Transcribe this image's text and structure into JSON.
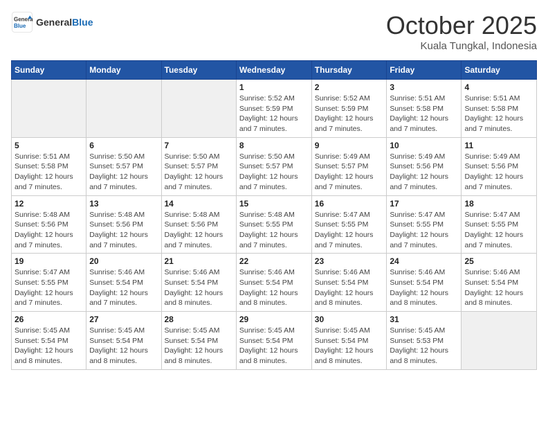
{
  "logo": {
    "general": "General",
    "blue": "Blue"
  },
  "header": {
    "month": "October 2025",
    "location": "Kuala Tungkal, Indonesia"
  },
  "weekdays": [
    "Sunday",
    "Monday",
    "Tuesday",
    "Wednesday",
    "Thursday",
    "Friday",
    "Saturday"
  ],
  "weeks": [
    [
      {
        "day": "",
        "info": "",
        "empty": true
      },
      {
        "day": "",
        "info": "",
        "empty": true
      },
      {
        "day": "",
        "info": "",
        "empty": true
      },
      {
        "day": "1",
        "info": "Sunrise: 5:52 AM\nSunset: 5:59 PM\nDaylight: 12 hours and 7 minutes."
      },
      {
        "day": "2",
        "info": "Sunrise: 5:52 AM\nSunset: 5:59 PM\nDaylight: 12 hours and 7 minutes."
      },
      {
        "day": "3",
        "info": "Sunrise: 5:51 AM\nSunset: 5:58 PM\nDaylight: 12 hours and 7 minutes."
      },
      {
        "day": "4",
        "info": "Sunrise: 5:51 AM\nSunset: 5:58 PM\nDaylight: 12 hours and 7 minutes."
      }
    ],
    [
      {
        "day": "5",
        "info": "Sunrise: 5:51 AM\nSunset: 5:58 PM\nDaylight: 12 hours and 7 minutes."
      },
      {
        "day": "6",
        "info": "Sunrise: 5:50 AM\nSunset: 5:57 PM\nDaylight: 12 hours and 7 minutes."
      },
      {
        "day": "7",
        "info": "Sunrise: 5:50 AM\nSunset: 5:57 PM\nDaylight: 12 hours and 7 minutes."
      },
      {
        "day": "8",
        "info": "Sunrise: 5:50 AM\nSunset: 5:57 PM\nDaylight: 12 hours and 7 minutes."
      },
      {
        "day": "9",
        "info": "Sunrise: 5:49 AM\nSunset: 5:57 PM\nDaylight: 12 hours and 7 minutes."
      },
      {
        "day": "10",
        "info": "Sunrise: 5:49 AM\nSunset: 5:56 PM\nDaylight: 12 hours and 7 minutes."
      },
      {
        "day": "11",
        "info": "Sunrise: 5:49 AM\nSunset: 5:56 PM\nDaylight: 12 hours and 7 minutes."
      }
    ],
    [
      {
        "day": "12",
        "info": "Sunrise: 5:48 AM\nSunset: 5:56 PM\nDaylight: 12 hours and 7 minutes."
      },
      {
        "day": "13",
        "info": "Sunrise: 5:48 AM\nSunset: 5:56 PM\nDaylight: 12 hours and 7 minutes."
      },
      {
        "day": "14",
        "info": "Sunrise: 5:48 AM\nSunset: 5:56 PM\nDaylight: 12 hours and 7 minutes."
      },
      {
        "day": "15",
        "info": "Sunrise: 5:48 AM\nSunset: 5:55 PM\nDaylight: 12 hours and 7 minutes."
      },
      {
        "day": "16",
        "info": "Sunrise: 5:47 AM\nSunset: 5:55 PM\nDaylight: 12 hours and 7 minutes."
      },
      {
        "day": "17",
        "info": "Sunrise: 5:47 AM\nSunset: 5:55 PM\nDaylight: 12 hours and 7 minutes."
      },
      {
        "day": "18",
        "info": "Sunrise: 5:47 AM\nSunset: 5:55 PM\nDaylight: 12 hours and 7 minutes."
      }
    ],
    [
      {
        "day": "19",
        "info": "Sunrise: 5:47 AM\nSunset: 5:55 PM\nDaylight: 12 hours and 7 minutes."
      },
      {
        "day": "20",
        "info": "Sunrise: 5:46 AM\nSunset: 5:54 PM\nDaylight: 12 hours and 7 minutes."
      },
      {
        "day": "21",
        "info": "Sunrise: 5:46 AM\nSunset: 5:54 PM\nDaylight: 12 hours and 8 minutes."
      },
      {
        "day": "22",
        "info": "Sunrise: 5:46 AM\nSunset: 5:54 PM\nDaylight: 12 hours and 8 minutes."
      },
      {
        "day": "23",
        "info": "Sunrise: 5:46 AM\nSunset: 5:54 PM\nDaylight: 12 hours and 8 minutes."
      },
      {
        "day": "24",
        "info": "Sunrise: 5:46 AM\nSunset: 5:54 PM\nDaylight: 12 hours and 8 minutes."
      },
      {
        "day": "25",
        "info": "Sunrise: 5:46 AM\nSunset: 5:54 PM\nDaylight: 12 hours and 8 minutes."
      }
    ],
    [
      {
        "day": "26",
        "info": "Sunrise: 5:45 AM\nSunset: 5:54 PM\nDaylight: 12 hours and 8 minutes."
      },
      {
        "day": "27",
        "info": "Sunrise: 5:45 AM\nSunset: 5:54 PM\nDaylight: 12 hours and 8 minutes."
      },
      {
        "day": "28",
        "info": "Sunrise: 5:45 AM\nSunset: 5:54 PM\nDaylight: 12 hours and 8 minutes."
      },
      {
        "day": "29",
        "info": "Sunrise: 5:45 AM\nSunset: 5:54 PM\nDaylight: 12 hours and 8 minutes."
      },
      {
        "day": "30",
        "info": "Sunrise: 5:45 AM\nSunset: 5:54 PM\nDaylight: 12 hours and 8 minutes."
      },
      {
        "day": "31",
        "info": "Sunrise: 5:45 AM\nSunset: 5:53 PM\nDaylight: 12 hours and 8 minutes."
      },
      {
        "day": "",
        "info": "",
        "empty": true
      }
    ]
  ]
}
